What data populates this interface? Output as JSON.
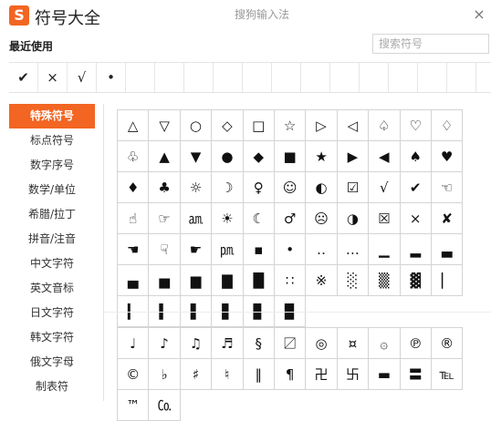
{
  "header": {
    "logo_letter": "S",
    "app_title": "符号大全",
    "window_title": "搜狗输入法",
    "close_glyph": "×"
  },
  "recent": {
    "label": "最近使用",
    "items": [
      "✔",
      "×",
      "√",
      "•",
      "",
      "",
      "",
      "",
      "",
      "",
      "",
      "",
      "",
      "",
      "",
      "",
      ""
    ]
  },
  "search": {
    "placeholder": "搜索符号",
    "value": ""
  },
  "sidebar": {
    "active_index": 0,
    "items": [
      "特殊符号",
      "标点符号",
      "数字序号",
      "数学/单位",
      "希腊/拉丁",
      "拼音/注音",
      "中文字符",
      "英文音标",
      "日文字符",
      "韩文字符",
      "俄文字母",
      "制表符"
    ]
  },
  "grid_top": [
    [
      "△",
      "▽",
      "○",
      "◇",
      "□",
      "☆",
      "▷",
      "◁",
      "♤",
      "♡",
      "♢",
      "♧"
    ],
    [
      "▲",
      "▼",
      "●",
      "◆",
      "■",
      "★",
      "▶",
      "◀",
      "♠",
      "♥",
      "♦",
      "♣"
    ],
    [
      "☼",
      "☽",
      "♀",
      "☺",
      "◐",
      "☑",
      "√",
      "✔",
      "☜",
      "☝",
      "☞",
      "㏂"
    ],
    [
      "☀",
      "☾",
      "♂",
      "☹",
      "◑",
      "☒",
      "×",
      "✘",
      "☚",
      "☟",
      "☛",
      "㏘"
    ],
    [
      "▪",
      "•",
      "‥",
      "…",
      "▁",
      "▂",
      "▃",
      "▄",
      "▅",
      "▆",
      "▇",
      "█"
    ],
    [
      "∷",
      "※",
      "░",
      "▒",
      "▓",
      "▏",
      "▎",
      "▍",
      "▌",
      "▋",
      "▊",
      "▉"
    ]
  ],
  "grid_bottom": [
    [
      "♩",
      "♪",
      "♫",
      "♬",
      "§",
      "〼",
      "◎",
      "¤",
      "۞",
      "℗",
      "®",
      "©"
    ],
    [
      "♭",
      "♯",
      "♮",
      "‖",
      "¶",
      "卍",
      "卐",
      "▬",
      "〓",
      "℡",
      "™",
      "㏇"
    ]
  ],
  "colors": {
    "accent": "#f26522",
    "grid_line": "#d4d4d4"
  }
}
